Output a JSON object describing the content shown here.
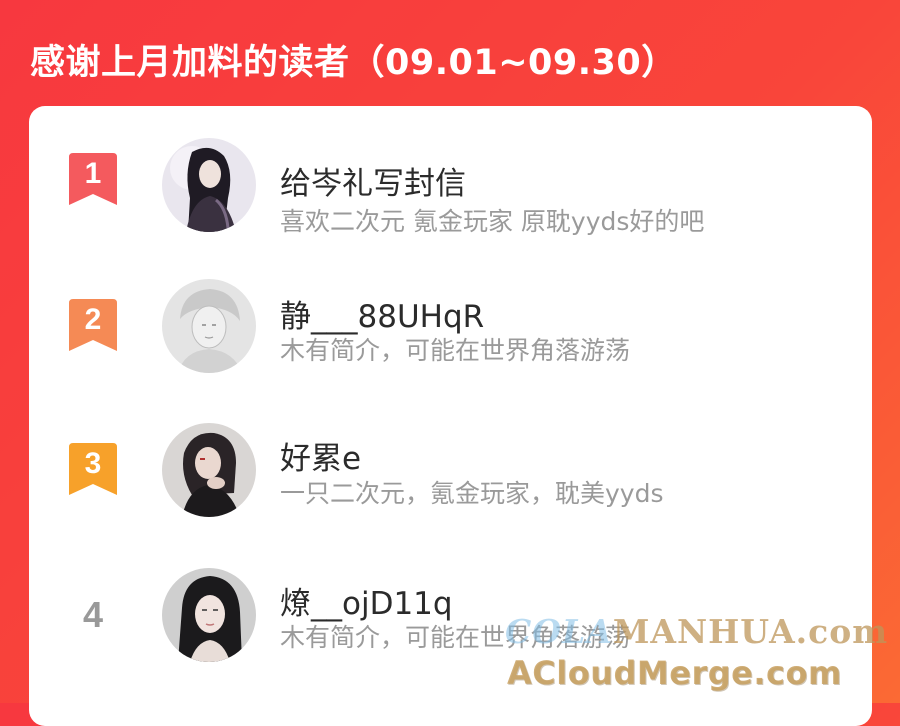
{
  "header": {
    "title": "感谢上月加料的读者（09.01~09.30）"
  },
  "readers": [
    {
      "rank": "1",
      "name": "给岑礼写封信",
      "bio": "喜欢二次元 氪金玩家 原耽yyds好的吧",
      "badge_color": "#f45a5e"
    },
    {
      "rank": "2",
      "name": "静___88UHqR",
      "bio": "木有简介，可能在世界角落游荡",
      "badge_color": "#f58a55"
    },
    {
      "rank": "3",
      "name": "好累e",
      "bio": "一只二次元，氪金玩家，耽美yyds",
      "badge_color": "#f7a12a"
    },
    {
      "rank": "4",
      "name": "燎__ojD11q",
      "bio": "木有简介，可能在世界角落游荡"
    }
  ],
  "watermark": {
    "line1_a": "COLA",
    "line1_b": "MANHUA.com",
    "line2": "ACloudMerge.com"
  },
  "colors": {
    "background_start": "#f7383f",
    "background_end": "#fb6a34",
    "card": "#ffffff",
    "name_text": "#2b2b2b",
    "bio_text": "#9a9a9a",
    "rank_plain": "#999999"
  }
}
